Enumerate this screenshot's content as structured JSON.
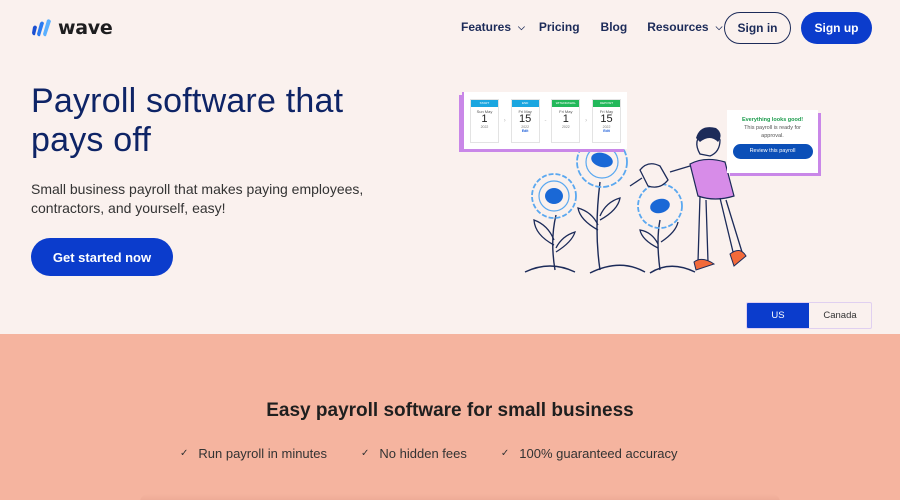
{
  "brand": {
    "name": "wave",
    "logo_icon": "wave-logo-icon",
    "accent_color": "#0b3ccc",
    "navy_color": "#0e2466"
  },
  "nav": {
    "links": [
      {
        "label": "Features",
        "has_dropdown": true
      },
      {
        "label": "Pricing",
        "has_dropdown": false
      },
      {
        "label": "Blog",
        "has_dropdown": false
      },
      {
        "label": "Resources",
        "has_dropdown": true
      }
    ],
    "sign_in": "Sign in",
    "sign_up": "Sign up"
  },
  "hero": {
    "title": "Payroll software that pays off",
    "subtitle": "Small business payroll that makes paying employees, contractors, and yourself, easy!",
    "cta": "Get started now"
  },
  "illustration": {
    "calendar_cards": [
      {
        "header": "START",
        "header_color": "#1aa6e0",
        "dow": "Sun May",
        "day": "1",
        "year": "2022",
        "edit": ""
      },
      {
        "header": "END",
        "header_color": "#1aa6e0",
        "dow": "Fri May",
        "day": "15",
        "year": "2022",
        "edit": "Edit"
      },
      {
        "header": "WITHDRAWAL",
        "header_color": "#22b85a",
        "dow": "Fri May",
        "day": "1",
        "year": "2022",
        "edit": ""
      },
      {
        "header": "DEPOSIT",
        "header_color": "#22b85a",
        "dow": "Fri May",
        "day": "15",
        "year": "2022",
        "edit": "Edit"
      }
    ],
    "approval": {
      "title": "Everything looks good!",
      "text": "This payroll is ready for approval.",
      "button": "Review this payroll"
    }
  },
  "region_toggle": {
    "options": [
      "US",
      "Canada"
    ],
    "selected": "US"
  },
  "section": {
    "title": "Easy payroll software for small business",
    "features": [
      "Run payroll in minutes",
      "No hidden fees",
      "100% guaranteed accuracy"
    ],
    "background_color": "#f5b49f"
  }
}
